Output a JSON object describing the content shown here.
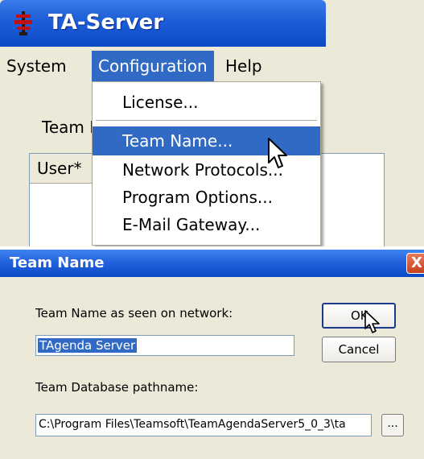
{
  "app": {
    "title": "TA-Server",
    "menu": [
      "System",
      "Configuration",
      "Help"
    ],
    "team_label": "Team I",
    "column_user": "User*"
  },
  "dropdown": {
    "items": [
      "License...",
      "Team Name...",
      "Network Protocols...",
      "Program Options...",
      "E-Mail Gateway..."
    ],
    "highlighted": "Team Name..."
  },
  "dialog": {
    "title": "Team Name",
    "network_label": "Team Name as seen on network:",
    "team_name_value": "TAgenda Server",
    "db_label": "Team Database pathname:",
    "db_path_value": "C:\\Program Files\\Teamsoft\\TeamAgendaServer5_0_3\\ta",
    "browse_label": "...",
    "ok_label": "OK",
    "cancel_label": "Cancel",
    "close_label": "X"
  },
  "colors": {
    "title_bar": "#0a4ac7",
    "highlight": "#316ac5",
    "close_button": "#c6401e",
    "window_bg": "#ece9d8"
  }
}
